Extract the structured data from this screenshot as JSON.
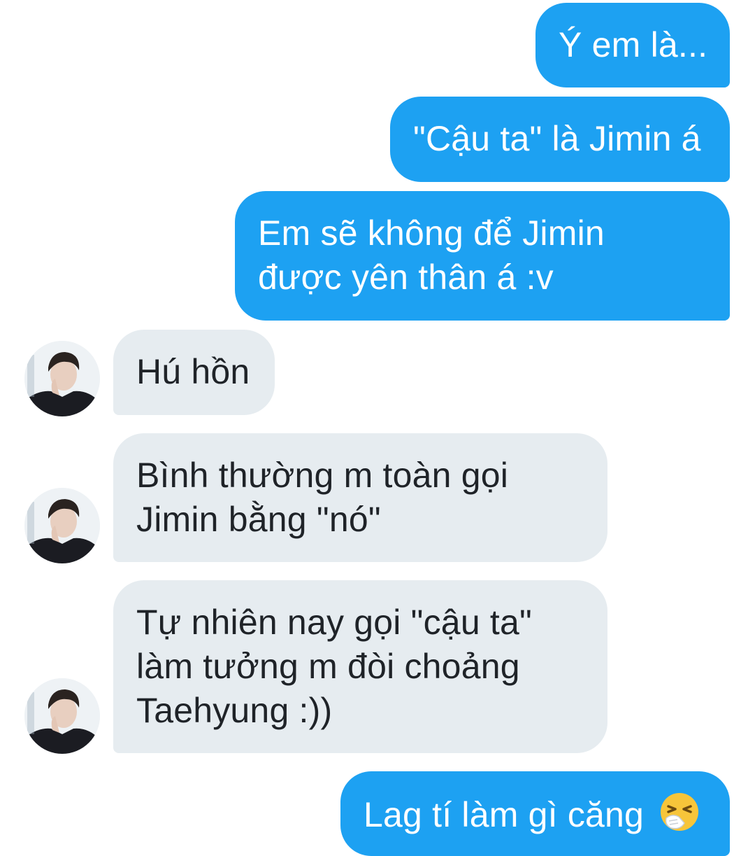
{
  "conversation": {
    "messages": [
      {
        "from": "me",
        "lines": [
          "Ý em là..."
        ]
      },
      {
        "from": "me",
        "lines": [
          "\"Cậu ta\" là Jimin á"
        ]
      },
      {
        "from": "me",
        "lines": [
          "Em sẽ không để Jimin",
          "được yên thân á :v"
        ]
      },
      {
        "from": "them",
        "lines": [
          "Hú hồn"
        ]
      },
      {
        "from": "them",
        "lines": [
          "Bình thường m toàn gọi",
          "Jimin bằng \"nó\""
        ]
      },
      {
        "from": "them",
        "lines": [
          "Tự nhiên nay gọi \"cậu ta\"",
          "làm tưởng m đòi choảng",
          "Taehyung :))"
        ]
      },
      {
        "from": "me",
        "lines": [
          "Lag tí làm gì căng"
        ],
        "emoji": "sneezing-face-icon"
      }
    ]
  },
  "colors": {
    "sent_bubble": "#1da1f2",
    "received_bubble": "#e6ecf0",
    "sent_text": "#ffffff",
    "received_text": "#1f2328"
  }
}
